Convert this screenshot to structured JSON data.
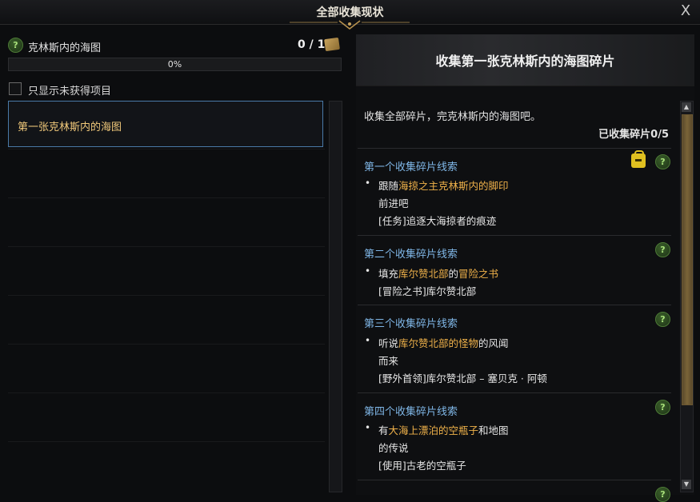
{
  "window": {
    "title": "全部收集现状",
    "close_label": "X"
  },
  "left": {
    "map_name": "克林斯内的海图",
    "count": "0 / 1",
    "progress_fraction": 0.0,
    "progress_text": "0%",
    "filter_label": "只显示未获得项目",
    "filter_checked": false,
    "items": [
      {
        "label": "第一张克林斯内的海图",
        "selected": true
      }
    ]
  },
  "right": {
    "title": "收集第一张克林斯内的海图碎片",
    "description": "收集全部碎片，完克林斯内的海图吧。",
    "collected": "已收集碎片0/5",
    "clues": [
      {
        "title": "第一个收集碎片线索",
        "line1_pre": "跟随",
        "line1_hl": "海掠之主克林斯内的脚印",
        "line1_post": "",
        "line2": "前进吧",
        "line3": "[任务]追逐大海掠者的痕迹"
      },
      {
        "title": "第二个收集碎片线索",
        "line1_pre": "填充",
        "line1_hl": "库尔赞北部",
        "line1_mid": "的",
        "line1_hl2": "冒险之书",
        "line2": "[冒险之书]库尔赞北部"
      },
      {
        "title": "第三个收集碎片线索",
        "line1_pre": "听说",
        "line1_hl": "库尔赞北部的怪物",
        "line1_post": "的风闻",
        "line2": "而来",
        "line3": "[野外首领]库尔赞北部 – 塞贝克 · 阿顿"
      },
      {
        "title": "第四个收集碎片线索",
        "line1_pre": "有",
        "line1_hl": "大海上漂泊的空瓶子",
        "line1_post": "和地图",
        "line2": "的传说",
        "line3": "[使用]古老的空瓶子"
      }
    ]
  },
  "icons": {
    "help": "question-icon",
    "map": "map-scroll-icon",
    "bag": "bag-icon",
    "close": "close-icon"
  },
  "colors": {
    "highlight": "#f0b24a",
    "clue_title": "#7fb6e6",
    "help_green": "#a8e07a",
    "selected_border": "#4a7aa8"
  }
}
